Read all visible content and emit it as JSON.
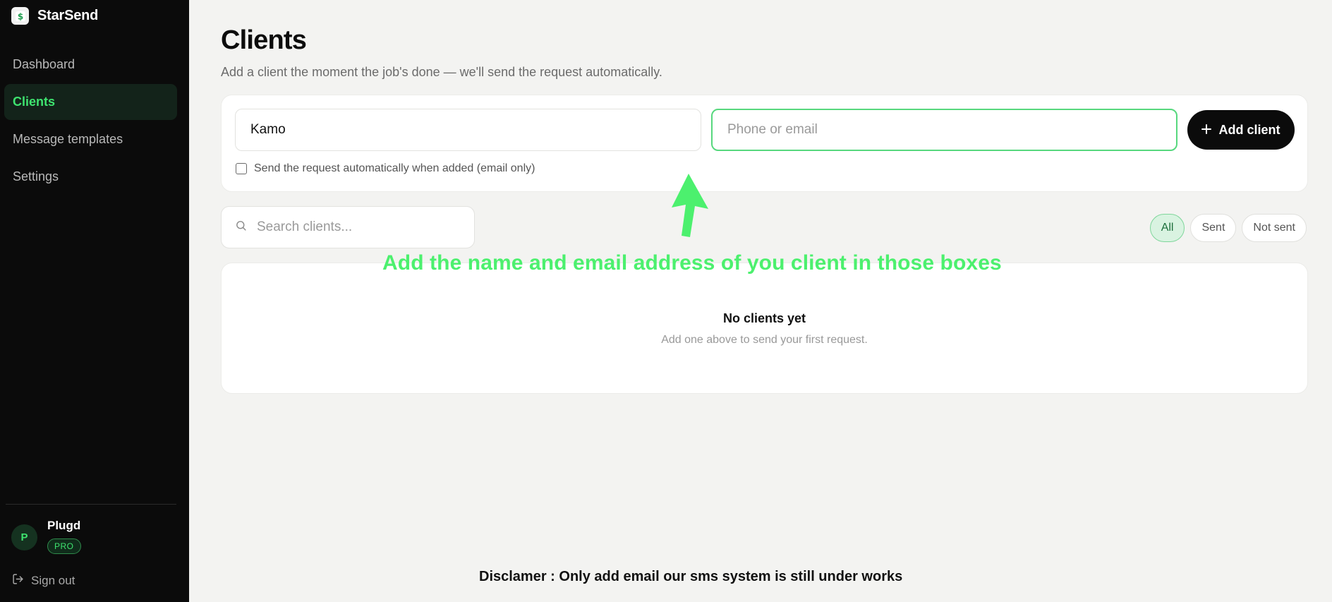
{
  "brand": {
    "name": "StarSend",
    "logo_icon": "dollar-icon"
  },
  "sidebar": {
    "items": [
      {
        "label": "Dashboard",
        "active": false
      },
      {
        "label": "Clients",
        "active": true
      },
      {
        "label": "Message templates",
        "active": false
      },
      {
        "label": "Settings",
        "active": false
      }
    ],
    "user": {
      "initial": "P",
      "name": "Plugd",
      "plan": "PRO"
    },
    "signout_label": "Sign out"
  },
  "page": {
    "title": "Clients",
    "subtitle": "Add a client the moment the job's done — we'll send the request automatically."
  },
  "add_form": {
    "name_value": "Kamo",
    "contact_placeholder": "Phone or email",
    "add_button_label": "Add client",
    "auto_send_label": "Send the request automatically when added (email only)",
    "auto_send_checked": false
  },
  "search": {
    "placeholder": "Search clients..."
  },
  "filters": [
    {
      "label": "All",
      "active": true
    },
    {
      "label": "Sent",
      "active": false
    },
    {
      "label": "Not sent",
      "active": false
    }
  ],
  "empty_state": {
    "title": "No clients yet",
    "subtitle": "Add one above to send your first request."
  },
  "annotation": {
    "text": "Add the name and email address of you client in those boxes",
    "color": "#4cf06e"
  },
  "disclaimer": "Disclamer : Only add email our sms system is still under works",
  "colors": {
    "accent": "#3ee36f",
    "sidebar_bg": "#0b0b0b",
    "page_bg": "#f3f3f1"
  }
}
